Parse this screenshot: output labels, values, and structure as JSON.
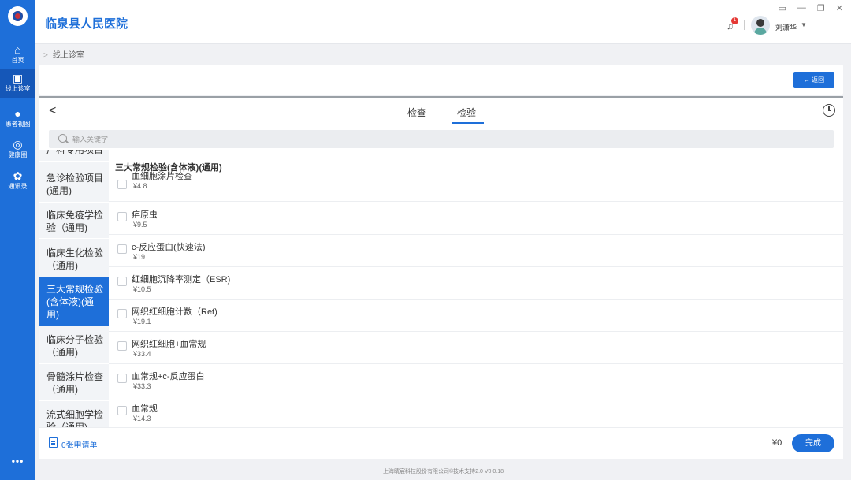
{
  "app": {
    "title": "临泉县人民医院"
  },
  "rail": {
    "items": [
      {
        "icon": "home-icon",
        "label": "首页"
      },
      {
        "icon": "consult-icon",
        "label": "线上诊室"
      },
      {
        "icon": "patient-icon",
        "label": "患者视图"
      },
      {
        "icon": "health-icon",
        "label": "健康圈"
      },
      {
        "icon": "contacts-icon",
        "label": "通讯录"
      }
    ],
    "more": "•••"
  },
  "header": {
    "notification_count": "1",
    "user_name": "刘潇华"
  },
  "breadcrumb": {
    "current": "线上诊室"
  },
  "toolbar": {
    "back_label": "← 返回"
  },
  "main": {
    "tabs": [
      "检查",
      "检验"
    ],
    "active_tab": "检验",
    "search_placeholder": "输入关键字",
    "categories": [
      "广科专用项目",
      "急诊检验项目(通用)",
      "临床免疫学检验（通用)",
      "临床生化检验（通用)",
      "三大常规检验(含体液)(通用)",
      "临床分子检验（通用)",
      "骨髓涂片检查（通用)",
      "流式细胞学检验（通用)"
    ],
    "active_category": "三大常规检验(含体液)(通用)",
    "group_title": "三大常规检验(含体液)(通用)",
    "tests": [
      {
        "name": "血细胞涂片检查",
        "price": "¥4.8"
      },
      {
        "name": "疟原虫",
        "price": "¥9.5"
      },
      {
        "name": "c-反应蛋白(快速法)",
        "price": "¥19"
      },
      {
        "name": "红细胞沉降率测定（ESR)",
        "price": "¥10.5"
      },
      {
        "name": "网织红细胞计数（Ret)",
        "price": "¥19.1"
      },
      {
        "name": "网织红细胞+血常规",
        "price": "¥33.4"
      },
      {
        "name": "血常规+c-反应蛋白",
        "price": "¥33.3"
      },
      {
        "name": "血常规",
        "price": "¥14.3"
      }
    ]
  },
  "footer": {
    "request_count": "0张申请单",
    "total": "¥0",
    "done_label": "完成"
  },
  "copyright": "上海晴宸科技股份有限公司©技术支持2.0 V0.0.18",
  "colors": {
    "accent": "#1e6fd9",
    "badge": "#e53935"
  }
}
